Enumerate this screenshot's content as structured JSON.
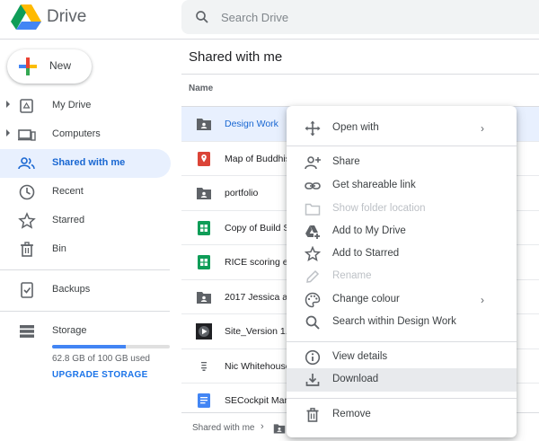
{
  "app": {
    "name": "Drive"
  },
  "search": {
    "placeholder": "Search Drive"
  },
  "sidebar": {
    "new_label": "New",
    "items": [
      {
        "label": "My Drive",
        "icon": "my-drive-icon"
      },
      {
        "label": "Computers",
        "icon": "computers-icon"
      },
      {
        "label": "Shared with me",
        "icon": "shared-with-me-icon"
      },
      {
        "label": "Recent",
        "icon": "clock-icon"
      },
      {
        "label": "Starred",
        "icon": "star-icon"
      },
      {
        "label": "Bin",
        "icon": "trash-icon"
      },
      {
        "label": "Backups",
        "icon": "backups-icon"
      },
      {
        "label": "Storage",
        "icon": "storage-icon"
      }
    ],
    "storage": {
      "used_text": "62.8 GB of 100 GB used",
      "used_fraction": 0.628,
      "upgrade_label": "UPGRADE STORAGE"
    }
  },
  "main": {
    "title": "Shared with me",
    "column_name": "Name",
    "files": [
      {
        "name": "Design Work",
        "type": "shared-folder"
      },
      {
        "name": "Map of Buddhis",
        "type": "map"
      },
      {
        "name": "portfolio",
        "type": "shared-folder"
      },
      {
        "name": "Copy of Build S",
        "type": "sheet"
      },
      {
        "name": "RICE scoring ex",
        "type": "sheet"
      },
      {
        "name": "2017 Jessica a",
        "type": "shared-folder"
      },
      {
        "name": "Site_Version 1.",
        "type": "video"
      },
      {
        "name": "Nic Whitehouse",
        "type": "file"
      },
      {
        "name": "SECockpit Man",
        "type": "doc"
      }
    ],
    "breadcrumb": {
      "root": "Shared with me",
      "separator": "›"
    }
  },
  "context_menu": {
    "items": [
      {
        "label": "Open with",
        "icon": "open-with-icon",
        "submenu": "›"
      },
      {
        "label": "Share",
        "icon": "share-person-icon"
      },
      {
        "label": "Get shareable link",
        "icon": "link-icon"
      },
      {
        "label": "Show folder location",
        "icon": "folder-outline-icon",
        "disabled": true
      },
      {
        "label": "Add to My Drive",
        "icon": "add-to-drive-icon"
      },
      {
        "label": "Add to Starred",
        "icon": "star-outline-icon"
      },
      {
        "label": "Rename",
        "icon": "pencil-icon",
        "disabled": true
      },
      {
        "label": "Change colour",
        "icon": "palette-icon",
        "submenu": "›"
      },
      {
        "label": "Search within Design Work",
        "icon": "search-icon"
      },
      {
        "label": "View details",
        "icon": "info-icon"
      },
      {
        "label": "Download",
        "icon": "download-icon"
      },
      {
        "label": "Remove",
        "icon": "trash-icon"
      }
    ]
  },
  "colors": {
    "accent": "#1a73e8",
    "active_bg": "#e8f0fe",
    "active_text": "#1967d2"
  }
}
